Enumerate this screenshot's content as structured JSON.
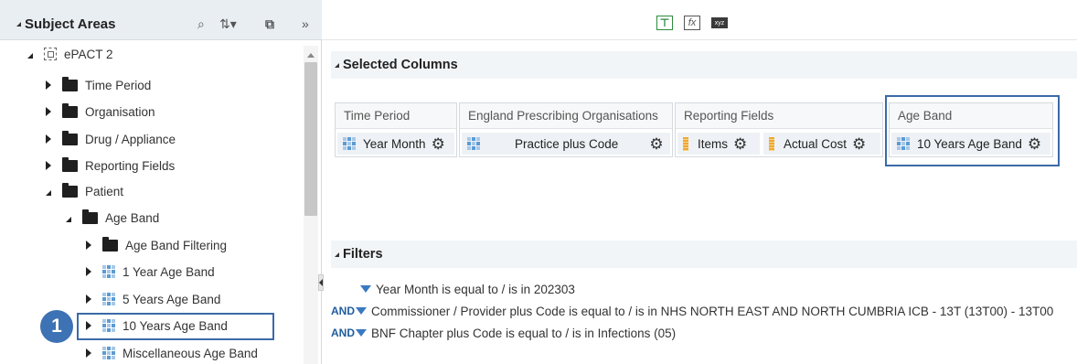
{
  "left_panel": {
    "title": "Subject Areas",
    "icons": [
      "search-icon",
      "sort-icon",
      "add-icon",
      "collapse-panel-icon"
    ],
    "tree": [
      {
        "label": "ePACT 2",
        "type": "subject-area",
        "expanded": true
      },
      {
        "label": "Time Period",
        "type": "folder",
        "expanded": false
      },
      {
        "label": "Organisation",
        "type": "folder",
        "expanded": false
      },
      {
        "label": "Drug / Appliance",
        "type": "folder",
        "expanded": false
      },
      {
        "label": "Reporting Fields",
        "type": "folder",
        "expanded": false
      },
      {
        "label": "Patient",
        "type": "folder",
        "expanded": true
      },
      {
        "label": "Age Band",
        "type": "folder",
        "expanded": true
      },
      {
        "label": "Age Band Filtering",
        "type": "folder",
        "expanded": false
      },
      {
        "label": "1 Year Age Band",
        "type": "column",
        "expanded": false
      },
      {
        "label": "5 Years Age Band",
        "type": "column",
        "expanded": false
      },
      {
        "label": "10 Years Age Band",
        "type": "column",
        "expanded": false
      },
      {
        "label": "Miscellaneous Age Band",
        "type": "column",
        "expanded": false
      }
    ],
    "step_badge": "1"
  },
  "toolbar": {
    "xyz_label": "xyz"
  },
  "selected_columns": {
    "title": "Selected Columns",
    "groups": [
      {
        "title": "Time Period",
        "columns": [
          {
            "label": "Year Month",
            "type": "attribute"
          }
        ]
      },
      {
        "title": "England Prescribing Organisations",
        "columns": [
          {
            "label": "Practice plus Code",
            "type": "attribute"
          }
        ]
      },
      {
        "title": "Reporting Fields",
        "columns": [
          {
            "label": "Items",
            "type": "measure"
          },
          {
            "label": "Actual Cost",
            "type": "measure"
          }
        ]
      },
      {
        "title": "Age Band",
        "columns": [
          {
            "label": "10 Years Age Band",
            "type": "attribute"
          }
        ]
      }
    ]
  },
  "filters": {
    "title": "Filters",
    "items": [
      {
        "prefix": "",
        "text": "Year Month is equal to / is in  202303"
      },
      {
        "prefix": "AND",
        "text": "Commissioner / Provider plus Code is equal to / is in  NHS NORTH EAST AND NORTH CUMBRIA ICB - 13T (13T00) - 13T00"
      },
      {
        "prefix": "AND",
        "text": "BNF Chapter plus Code is equal to / is in  Infections (05)"
      }
    ]
  },
  "colors": {
    "highlight_border": "#3b6aa8",
    "badge_bg": "#3d72b4",
    "and_keyword": "#1f5c9e"
  }
}
